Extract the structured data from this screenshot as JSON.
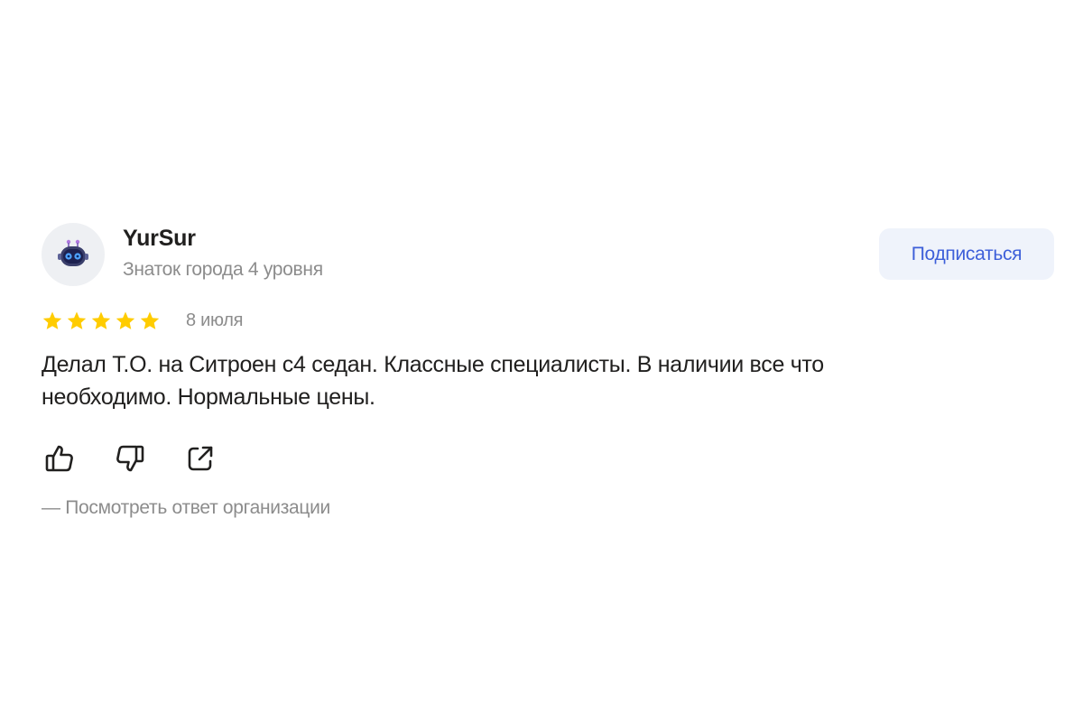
{
  "author": {
    "name": "YurSur",
    "level": "Знаток города 4 уровня",
    "avatar_icon": "robot-avatar-icon"
  },
  "subscribe_label": "Подписаться",
  "review": {
    "rating": 5,
    "rating_max": 5,
    "date": "8 июля",
    "text": "Делал Т.О. на Ситроен с4 седан. Классные специалисты. В наличии все что необходимо. Нормальные цены."
  },
  "actions": {
    "like_icon": "thumbs-up-icon",
    "dislike_icon": "thumbs-down-icon",
    "share_icon": "share-icon"
  },
  "org_response_label": "— Посмотреть ответ организации",
  "colors": {
    "star": "#fc0",
    "accent": "#3d5fd9",
    "button_bg": "#eff3fb",
    "muted_text": "#8c8c8c",
    "main_text": "#21201f"
  }
}
